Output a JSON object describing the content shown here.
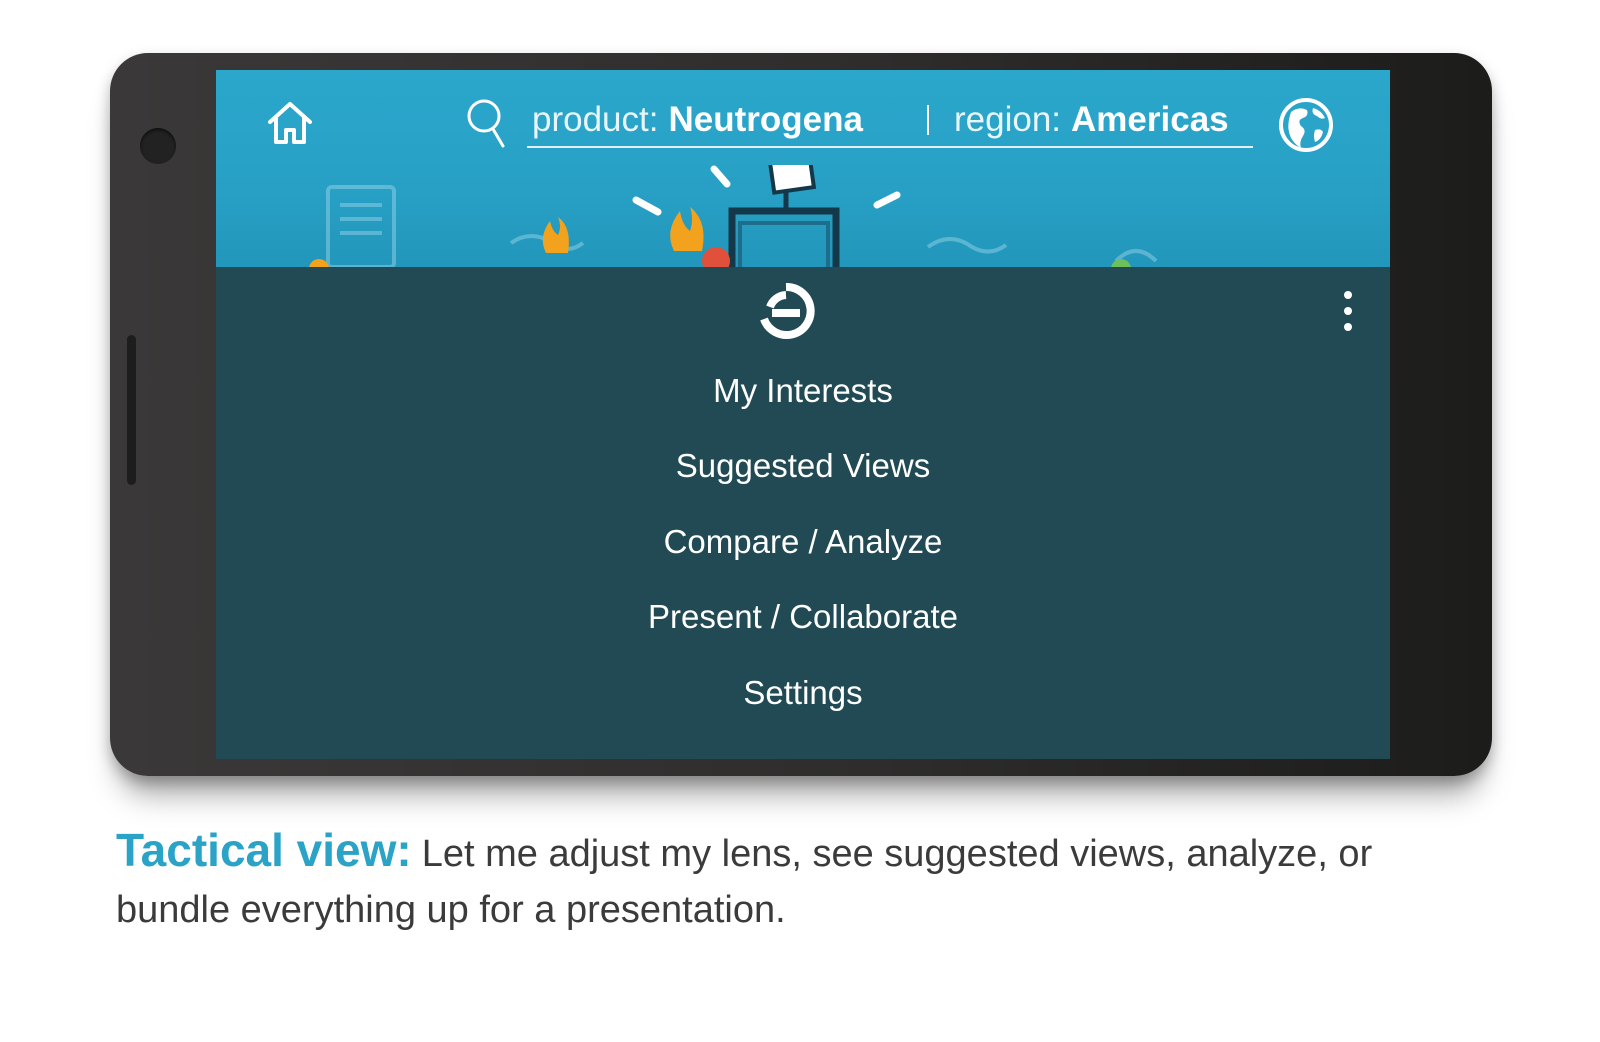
{
  "search": {
    "product_label": "product:",
    "product_value": "Neutrogena",
    "region_label": "region:",
    "region_value": "Americas"
  },
  "icons": {
    "home": "home-icon",
    "search": "search-icon",
    "globe": "globe-icon",
    "logo": "app-logo-icon",
    "more": "more-vertical-icon"
  },
  "menu": {
    "items": [
      {
        "label": "My Interests"
      },
      {
        "label": "Suggested Views"
      },
      {
        "label": "Compare / Analyze"
      },
      {
        "label": "Present / Collaborate"
      },
      {
        "label": "Settings"
      }
    ]
  },
  "caption": {
    "lead": "Tactical view:",
    "text": "Let me adjust my lens, see suggested views, analyze, or bundle everything up for a presentation."
  },
  "colors": {
    "header_blue": "#2ba7cc",
    "menu_teal": "#214a55",
    "caption_accent": "#2aa3c7",
    "phone_body": "#2e2d2c"
  }
}
